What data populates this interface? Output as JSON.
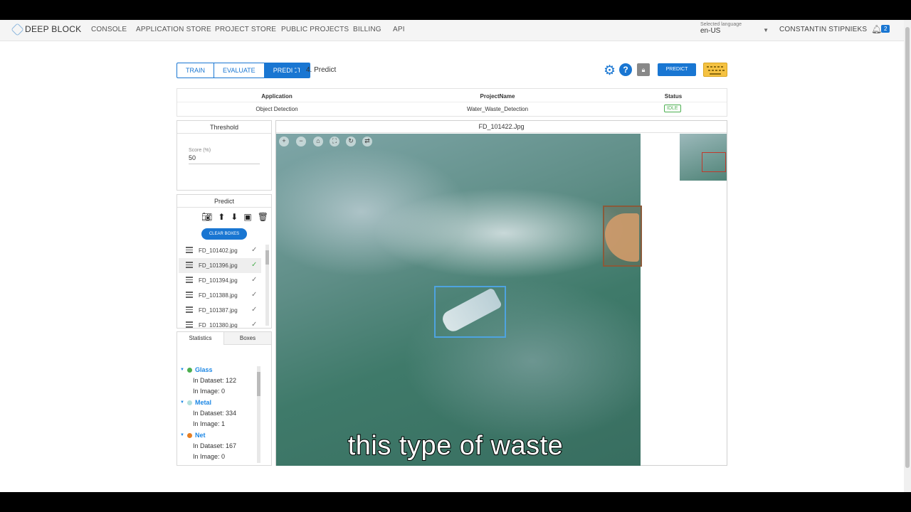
{
  "nav": {
    "logo": "DEEP BLOCK",
    "items": [
      "CONSOLE",
      "APPLICATION STORE",
      "PROJECT STORE",
      "PUBLIC PROJECTS",
      "BILLING",
      "API"
    ],
    "language_caption": "Selected language",
    "language_value": "en-US",
    "user": "CONSTANTIN STIPNIEKS",
    "notifications": "2"
  },
  "toolbar": {
    "tabs": [
      "TRAIN",
      "EVALUATE",
      "PREDICT"
    ],
    "active_tab": "PREDICT",
    "step": "4. Predict",
    "predict_label": "PREDICT"
  },
  "info": {
    "headers": [
      "Application",
      "ProjectName",
      "Status"
    ],
    "application": "Object Detection",
    "project": "Water_Waste_Detection",
    "status": "IDLE",
    "status_color": "#4caf50"
  },
  "threshold": {
    "title": "Threshold",
    "caption": "Score (%)",
    "value": "50"
  },
  "predict": {
    "title": "Predict",
    "clear_label": "CLEAR BOXES",
    "files": [
      "FD_101402.jpg",
      "FD_101396.jpg",
      "FD_101394.jpg",
      "FD_101388.jpg",
      "FD_101387.jpg",
      "FD_101380.jpg"
    ]
  },
  "stats": {
    "tabs": [
      "Statistics",
      "Boxes"
    ],
    "classes": [
      {
        "name": "Glass",
        "color": "#4caf50",
        "in_dataset": "In Dataset: 122",
        "in_image": "In Image: 0"
      },
      {
        "name": "Metal",
        "color": "#b2dfdb",
        "in_dataset": "In Dataset: 334",
        "in_image": "In Image: 1"
      },
      {
        "name": "Net",
        "color": "#e67e22",
        "in_dataset": "In Dataset: 167",
        "in_image": "In Image: 0"
      }
    ]
  },
  "viewer": {
    "title": "FD_101422.Jpg"
  },
  "caption": "this type of waste"
}
